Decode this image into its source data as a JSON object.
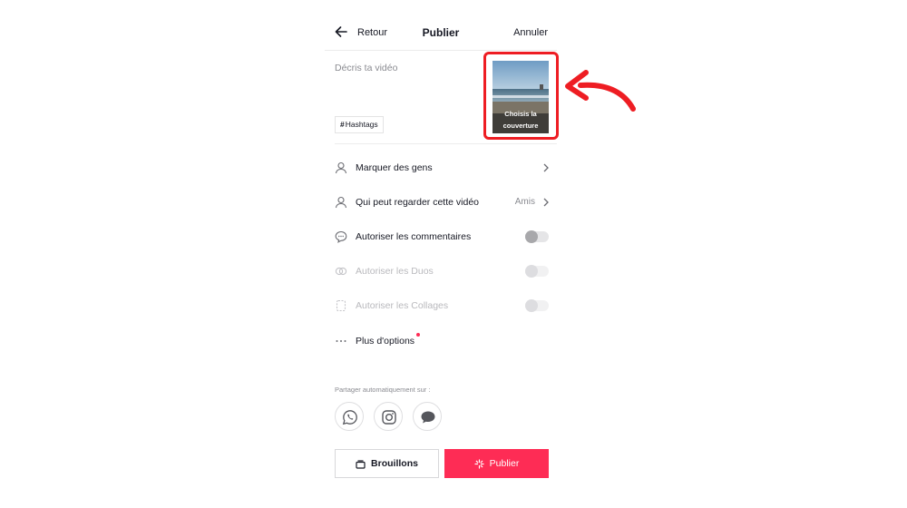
{
  "header": {
    "back_label": "Retour",
    "title": "Publier",
    "cancel_label": "Annuler"
  },
  "description": {
    "placeholder": "Décris ta vidéo",
    "hashtag_label": "Hashtags",
    "cover_label_line1": "Choisis la",
    "cover_label_line2": "couverture"
  },
  "settings": [
    {
      "label": "Marquer des gens",
      "icon": "person-icon",
      "control": "chevron"
    },
    {
      "label": "Qui peut regarder cette vidéo",
      "value": "Amis",
      "icon": "person-icon",
      "control": "chevron"
    },
    {
      "label": "Autoriser les commentaires",
      "icon": "comment-icon",
      "control": "toggle",
      "enabled": true
    },
    {
      "label": "Autoriser les Duos",
      "icon": "duet-icon",
      "control": "toggle",
      "enabled": false
    },
    {
      "label": "Autoriser les Collages",
      "icon": "stitch-icon",
      "control": "toggle",
      "enabled": false
    },
    {
      "label": "Plus d'options",
      "icon": "more-icon",
      "control": "none",
      "has_notification_dot": true
    }
  ],
  "share": {
    "label": "Partager automatiquement sur :",
    "targets": [
      "whatsapp-icon",
      "instagram-icon",
      "message-icon"
    ]
  },
  "actions": {
    "drafts_label": "Brouillons",
    "publish_label": "Publier"
  },
  "colors": {
    "accent": "#fe2c55",
    "highlight": "#ee1d23"
  }
}
